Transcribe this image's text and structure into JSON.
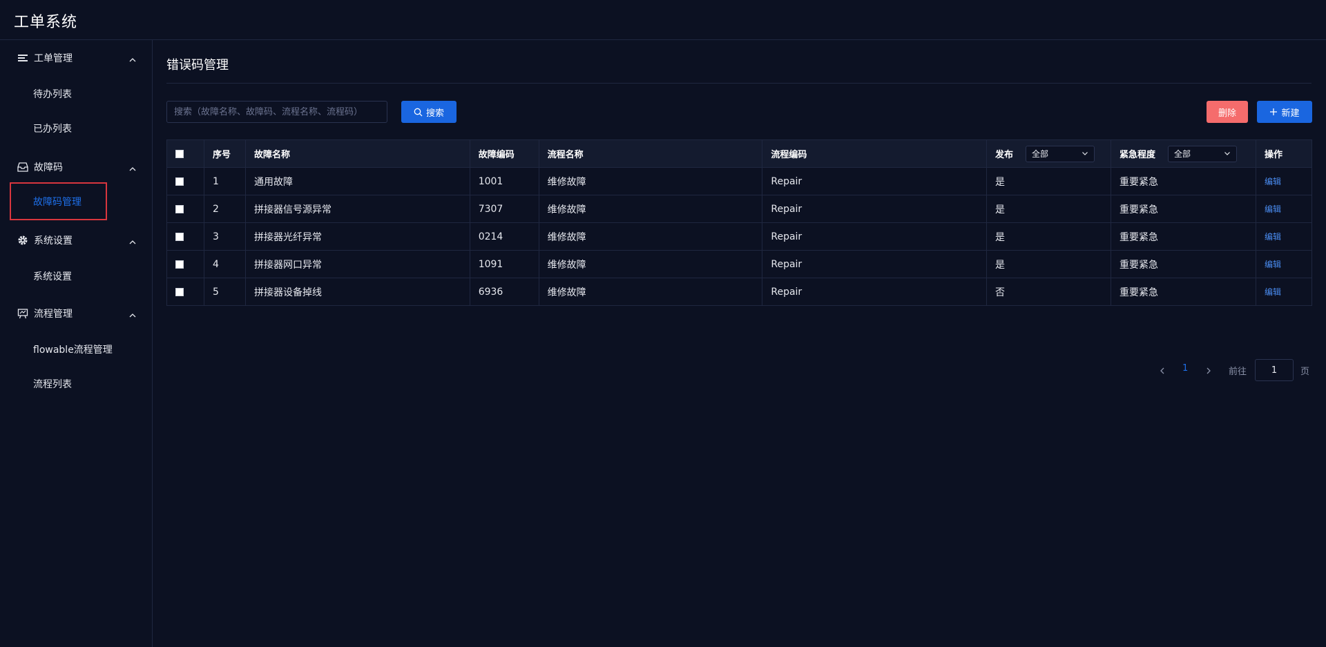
{
  "app": {
    "title": "工单系统"
  },
  "sidebar": {
    "groups": [
      {
        "label": "工单管理",
        "icon": "list-icon",
        "items": [
          {
            "label": "待办列表"
          },
          {
            "label": "已办列表"
          }
        ]
      },
      {
        "label": "故障码",
        "icon": "inbox-icon",
        "items": [
          {
            "label": "故障码管理",
            "active": true
          }
        ]
      },
      {
        "label": "系统设置",
        "icon": "gear-icon",
        "items": [
          {
            "label": "系统设置"
          }
        ]
      },
      {
        "label": "流程管理",
        "icon": "flow-board-icon",
        "items": [
          {
            "label": "flowable流程管理"
          },
          {
            "label": "流程列表"
          }
        ]
      }
    ]
  },
  "main": {
    "title": "错误码管理",
    "search": {
      "placeholder": "搜索（故障名称、故障码、流程名称、流程码）",
      "value": "",
      "button_label": "搜索"
    },
    "toolbar": {
      "delete_label": "删除",
      "new_label": "新建"
    },
    "table": {
      "columns": {
        "index": "序号",
        "fault_name": "故障名称",
        "fault_code": "故障编码",
        "flow_name": "流程名称",
        "flow_code": "流程编码",
        "publish": "发布",
        "urgency": "紧急程度",
        "action": "操作"
      },
      "filters": {
        "publish": "全部",
        "urgency": "全部"
      },
      "action_label": "编辑",
      "rows": [
        {
          "index": "1",
          "fault_name": "通用故障",
          "fault_code": "1001",
          "flow_name": "维修故障",
          "flow_code": "Repair",
          "publish": "是",
          "urgency": "重要紧急"
        },
        {
          "index": "2",
          "fault_name": "拼接器信号源异常",
          "fault_code": "7307",
          "flow_name": "维修故障",
          "flow_code": "Repair",
          "publish": "是",
          "urgency": "重要紧急"
        },
        {
          "index": "3",
          "fault_name": "拼接器光纤异常",
          "fault_code": "0214",
          "flow_name": "维修故障",
          "flow_code": "Repair",
          "publish": "是",
          "urgency": "重要紧急"
        },
        {
          "index": "4",
          "fault_name": "拼接器网口异常",
          "fault_code": "1091",
          "flow_name": "维修故障",
          "flow_code": "Repair",
          "publish": "是",
          "urgency": "重要紧急"
        },
        {
          "index": "5",
          "fault_name": "拼接器设备掉线",
          "fault_code": "6936",
          "flow_name": "维修故障",
          "flow_code": "Repair",
          "publish": "否",
          "urgency": "重要紧急"
        }
      ]
    },
    "pagination": {
      "current_page": "1",
      "goto_label": "前往",
      "goto_value": "1",
      "page_suffix": "页"
    }
  },
  "colors": {
    "background": "#0c1122",
    "accent": "#1a66e0",
    "danger": "#f56c6c",
    "active_highlight": "#d9363e"
  }
}
